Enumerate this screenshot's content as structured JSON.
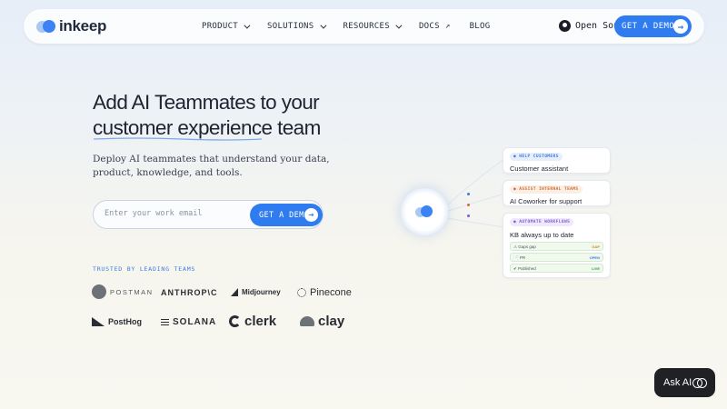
{
  "nav": {
    "logo_text": "inkeep",
    "items": [
      {
        "label": "PRODUCT",
        "type": "dropdown"
      },
      {
        "label": "SOLUTIONS",
        "type": "dropdown"
      },
      {
        "label": "RESOURCES",
        "type": "dropdown"
      },
      {
        "label": "DOCS",
        "type": "external"
      },
      {
        "label": "BLOG",
        "type": "link"
      }
    ],
    "open_source_label": "Open Source",
    "demo_label": "GET A DEMO"
  },
  "hero": {
    "title_line1": "Add AI Teammates to your",
    "title_line2_a": "customer experience",
    "title_line2_b": " team",
    "subtitle": "Deploy AI teammates that understand your data, product, knowledge, and tools.",
    "email_placeholder": "Enter your work email",
    "cta_label": "GET A DEMO"
  },
  "trusted": {
    "label": "TRUSTED BY LEADING TEAMS",
    "brands": [
      "POSTMAN",
      "ANTHROP\\C",
      "Midjourney",
      "Pinecone",
      "PostHog",
      "SOLANA",
      "clerk",
      "clay"
    ]
  },
  "illustration": {
    "cards": [
      {
        "tag": "● HELP CUSTOMERS",
        "title": "Customer assistant",
        "tag_color": "#3b7be0",
        "tag_bg": "#e6eefb"
      },
      {
        "tag": "● ASSIST INTERNAL TEAMS",
        "title": "AI Coworker for support",
        "tag_color": "#d26a2d",
        "tag_bg": "#fbeee4"
      },
      {
        "tag": "● AUTOMATE WORKFLOWS",
        "title": "KB always up to date",
        "tag_color": "#7c5bd6",
        "tag_bg": "#efe9fb",
        "rows": [
          {
            "left": "⚠ Gaps gap",
            "right": "GAP",
            "right_color": "#d9822b"
          },
          {
            "left": "📄 PR",
            "right": "OPEN",
            "right_color": "#3b7be0"
          },
          {
            "left": "✔ Published",
            "right": "LIVE",
            "right_color": "#2f9e44"
          }
        ]
      }
    ],
    "dot_colors": [
      "#3b7be0",
      "#e0643b",
      "#7c5bd6"
    ]
  },
  "ask_ai": {
    "label": "Ask AI"
  },
  "colors": {
    "accent": "#2f7cf0",
    "dark": "#1f2125"
  }
}
